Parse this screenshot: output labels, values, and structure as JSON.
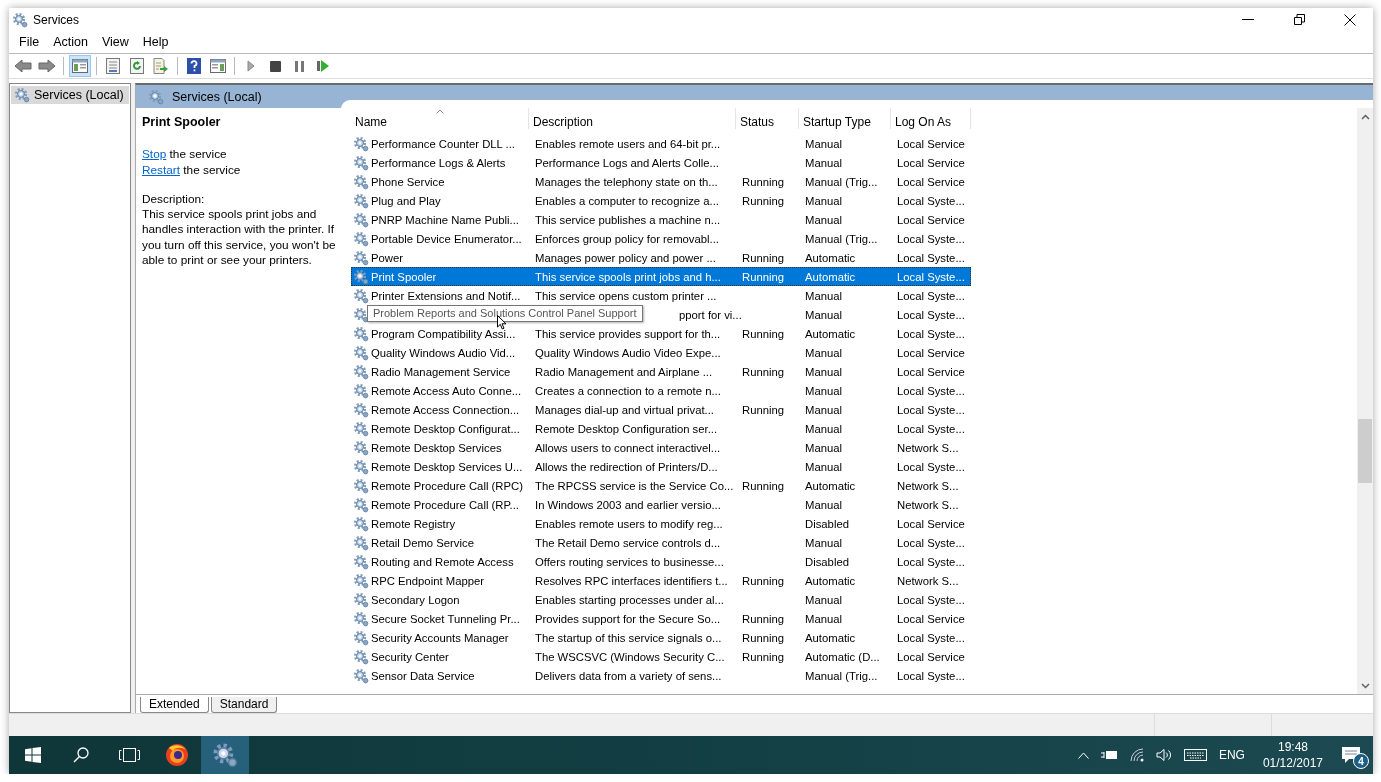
{
  "window": {
    "title": "Services"
  },
  "menu": [
    "File",
    "Action",
    "View",
    "Help"
  ],
  "toolbar": [
    {
      "kind": "back",
      "selected": false
    },
    {
      "kind": "forward",
      "selected": false
    },
    {
      "kind": "console-tree",
      "selected": true
    },
    {
      "kind": "properties",
      "selected": false
    },
    {
      "kind": "refresh",
      "selected": false
    },
    {
      "kind": "export",
      "selected": false
    },
    {
      "kind": "help",
      "selected": false
    },
    {
      "kind": "action-pane",
      "selected": false
    },
    {
      "kind": "start",
      "selected": false
    },
    {
      "kind": "stop",
      "selected": false
    },
    {
      "kind": "pause",
      "selected": false
    },
    {
      "kind": "restart",
      "selected": false
    }
  ],
  "tree": [
    {
      "label": "Services (Local)",
      "selected": true
    }
  ],
  "panel_header": "Services (Local)",
  "detail": {
    "title": "Print Spooler",
    "actions": [
      {
        "link": "Stop",
        "text": " the service"
      },
      {
        "link": "Restart",
        "text": " the service"
      }
    ],
    "description_label": "Description:",
    "description": "This service spools print jobs and handles interaction with the printer. If you turn off this service, you won't be able to print or see your printers."
  },
  "table": {
    "columns": [
      {
        "label": "Name",
        "sorted": true
      },
      {
        "label": "Description",
        "sorted": false
      },
      {
        "label": "Status",
        "sorted": false
      },
      {
        "label": "Startup Type",
        "sorted": false
      },
      {
        "label": "Log On As",
        "sorted": false
      }
    ],
    "rows": [
      {
        "name": "Performance Counter DLL ...",
        "description": "Enables remote users and 64-bit pr...",
        "status": "",
        "startup": "Manual",
        "logon": "Local Service",
        "selected": false
      },
      {
        "name": "Performance Logs & Alerts",
        "description": "Performance Logs and Alerts Colle...",
        "status": "",
        "startup": "Manual",
        "logon": "Local Service",
        "selected": false
      },
      {
        "name": "Phone Service",
        "description": "Manages the telephony state on th...",
        "status": "Running",
        "startup": "Manual (Trig...",
        "logon": "Local Service",
        "selected": false
      },
      {
        "name": "Plug and Play",
        "description": "Enables a computer to recognize a...",
        "status": "Running",
        "startup": "Manual",
        "logon": "Local Syste...",
        "selected": false
      },
      {
        "name": "PNRP Machine Name Publi...",
        "description": "This service publishes a machine n...",
        "status": "",
        "startup": "Manual",
        "logon": "Local Service",
        "selected": false
      },
      {
        "name": "Portable Device Enumerator...",
        "description": "Enforces group policy for removabl...",
        "status": "",
        "startup": "Manual (Trig...",
        "logon": "Local Syste...",
        "selected": false
      },
      {
        "name": "Power",
        "description": "Manages power policy and power ...",
        "status": "Running",
        "startup": "Automatic",
        "logon": "Local Syste...",
        "selected": false
      },
      {
        "name": "Print Spooler",
        "description": "This service spools print jobs and h...",
        "status": "Running",
        "startup": "Automatic",
        "logon": "Local Syste...",
        "selected": true
      },
      {
        "name": "Printer Extensions and Notif...",
        "description": "This service opens custom printer ...",
        "status": "",
        "startup": "Manual",
        "logon": "Local Syste...",
        "selected": false
      },
      {
        "name": "",
        "tooltip": "Problem Reports and Solutions Control Panel Support",
        "description": "pport for vi...",
        "status": "",
        "startup": "Manual",
        "logon": "Local Syste...",
        "selected": false
      },
      {
        "name": "Program Compatibility Assi...",
        "description": "This service provides support for th...",
        "status": "Running",
        "startup": "Automatic",
        "logon": "Local Syste...",
        "selected": false
      },
      {
        "name": "Quality Windows Audio Vid...",
        "description": "Quality Windows Audio Video Expe...",
        "status": "",
        "startup": "Manual",
        "logon": "Local Service",
        "selected": false
      },
      {
        "name": "Radio Management Service",
        "description": "Radio Management and Airplane ...",
        "status": "Running",
        "startup": "Manual",
        "logon": "Local Service",
        "selected": false
      },
      {
        "name": "Remote Access Auto Conne...",
        "description": "Creates a connection to a remote n...",
        "status": "",
        "startup": "Manual",
        "logon": "Local Syste...",
        "selected": false
      },
      {
        "name": "Remote Access Connection...",
        "description": "Manages dial-up and virtual privat...",
        "status": "Running",
        "startup": "Manual",
        "logon": "Local Syste...",
        "selected": false
      },
      {
        "name": "Remote Desktop Configurat...",
        "description": "Remote Desktop Configuration ser...",
        "status": "",
        "startup": "Manual",
        "logon": "Local Syste...",
        "selected": false
      },
      {
        "name": "Remote Desktop Services",
        "description": "Allows users to connect interactivel...",
        "status": "",
        "startup": "Manual",
        "logon": "Network S...",
        "selected": false
      },
      {
        "name": "Remote Desktop Services U...",
        "description": "Allows the redirection of Printers/D...",
        "status": "",
        "startup": "Manual",
        "logon": "Local Syste...",
        "selected": false
      },
      {
        "name": "Remote Procedure Call (RPC)",
        "description": "The RPCSS service is the Service Co...",
        "status": "Running",
        "startup": "Automatic",
        "logon": "Network S...",
        "selected": false
      },
      {
        "name": "Remote Procedure Call (RP...",
        "description": "In Windows 2003 and earlier versio...",
        "status": "",
        "startup": "Manual",
        "logon": "Network S...",
        "selected": false
      },
      {
        "name": "Remote Registry",
        "description": "Enables remote users to modify reg...",
        "status": "",
        "startup": "Disabled",
        "logon": "Local Service",
        "selected": false
      },
      {
        "name": "Retail Demo Service",
        "description": "The Retail Demo service controls d...",
        "status": "",
        "startup": "Manual",
        "logon": "Local Syste...",
        "selected": false
      },
      {
        "name": "Routing and Remote Access",
        "description": "Offers routing services to businesse...",
        "status": "",
        "startup": "Disabled",
        "logon": "Local Syste...",
        "selected": false
      },
      {
        "name": "RPC Endpoint Mapper",
        "description": "Resolves RPC interfaces identifiers t...",
        "status": "Running",
        "startup": "Automatic",
        "logon": "Network S...",
        "selected": false
      },
      {
        "name": "Secondary Logon",
        "description": "Enables starting processes under al...",
        "status": "",
        "startup": "Manual",
        "logon": "Local Syste...",
        "selected": false
      },
      {
        "name": "Secure Socket Tunneling Pr...",
        "description": "Provides support for the Secure So...",
        "status": "Running",
        "startup": "Manual",
        "logon": "Local Service",
        "selected": false
      },
      {
        "name": "Security Accounts Manager",
        "description": "The startup of this service signals o...",
        "status": "Running",
        "startup": "Automatic",
        "logon": "Local Syste...",
        "selected": false
      },
      {
        "name": "Security Center",
        "description": "The WSCSVC (Windows Security C...",
        "status": "Running",
        "startup": "Automatic (D...",
        "logon": "Local Service",
        "selected": false
      },
      {
        "name": "Sensor Data Service",
        "description": "Delivers data from a variety of sens...",
        "status": "",
        "startup": "Manual (Trig...",
        "logon": "Local Syste...",
        "selected": false
      }
    ]
  },
  "tabs": [
    {
      "label": "Extended",
      "selected": true
    },
    {
      "label": "Standard",
      "selected": false
    }
  ],
  "taskbar": {
    "apps": [
      {
        "kind": "start",
        "active": false
      },
      {
        "kind": "search",
        "active": false
      },
      {
        "kind": "task-view",
        "active": false
      },
      {
        "kind": "browser",
        "active": false
      },
      {
        "kind": "services",
        "active": true
      }
    ],
    "tray": {
      "language": "ENG",
      "time": "19:48",
      "date": "01/12/2017",
      "notifications": "4"
    }
  }
}
